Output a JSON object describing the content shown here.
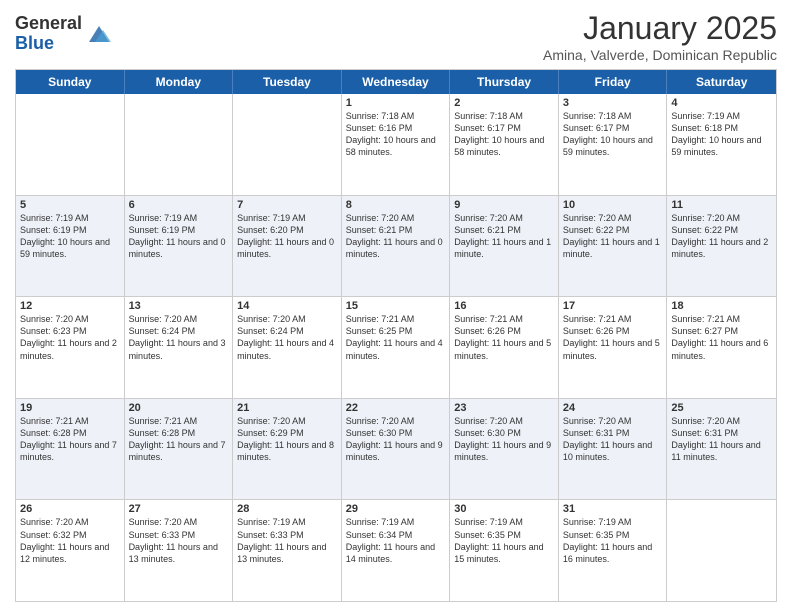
{
  "logo": {
    "general": "General",
    "blue": "Blue"
  },
  "header": {
    "month": "January 2025",
    "location": "Amina, Valverde, Dominican Republic"
  },
  "days": [
    "Sunday",
    "Monday",
    "Tuesday",
    "Wednesday",
    "Thursday",
    "Friday",
    "Saturday"
  ],
  "weeks": [
    [
      {
        "day": "",
        "info": ""
      },
      {
        "day": "",
        "info": ""
      },
      {
        "day": "",
        "info": ""
      },
      {
        "day": "1",
        "info": "Sunrise: 7:18 AM\nSunset: 6:16 PM\nDaylight: 10 hours and 58 minutes."
      },
      {
        "day": "2",
        "info": "Sunrise: 7:18 AM\nSunset: 6:17 PM\nDaylight: 10 hours and 58 minutes."
      },
      {
        "day": "3",
        "info": "Sunrise: 7:18 AM\nSunset: 6:17 PM\nDaylight: 10 hours and 59 minutes."
      },
      {
        "day": "4",
        "info": "Sunrise: 7:19 AM\nSunset: 6:18 PM\nDaylight: 10 hours and 59 minutes."
      }
    ],
    [
      {
        "day": "5",
        "info": "Sunrise: 7:19 AM\nSunset: 6:19 PM\nDaylight: 10 hours and 59 minutes."
      },
      {
        "day": "6",
        "info": "Sunrise: 7:19 AM\nSunset: 6:19 PM\nDaylight: 11 hours and 0 minutes."
      },
      {
        "day": "7",
        "info": "Sunrise: 7:19 AM\nSunset: 6:20 PM\nDaylight: 11 hours and 0 minutes."
      },
      {
        "day": "8",
        "info": "Sunrise: 7:20 AM\nSunset: 6:21 PM\nDaylight: 11 hours and 0 minutes."
      },
      {
        "day": "9",
        "info": "Sunrise: 7:20 AM\nSunset: 6:21 PM\nDaylight: 11 hours and 1 minute."
      },
      {
        "day": "10",
        "info": "Sunrise: 7:20 AM\nSunset: 6:22 PM\nDaylight: 11 hours and 1 minute."
      },
      {
        "day": "11",
        "info": "Sunrise: 7:20 AM\nSunset: 6:22 PM\nDaylight: 11 hours and 2 minutes."
      }
    ],
    [
      {
        "day": "12",
        "info": "Sunrise: 7:20 AM\nSunset: 6:23 PM\nDaylight: 11 hours and 2 minutes."
      },
      {
        "day": "13",
        "info": "Sunrise: 7:20 AM\nSunset: 6:24 PM\nDaylight: 11 hours and 3 minutes."
      },
      {
        "day": "14",
        "info": "Sunrise: 7:20 AM\nSunset: 6:24 PM\nDaylight: 11 hours and 4 minutes."
      },
      {
        "day": "15",
        "info": "Sunrise: 7:21 AM\nSunset: 6:25 PM\nDaylight: 11 hours and 4 minutes."
      },
      {
        "day": "16",
        "info": "Sunrise: 7:21 AM\nSunset: 6:26 PM\nDaylight: 11 hours and 5 minutes."
      },
      {
        "day": "17",
        "info": "Sunrise: 7:21 AM\nSunset: 6:26 PM\nDaylight: 11 hours and 5 minutes."
      },
      {
        "day": "18",
        "info": "Sunrise: 7:21 AM\nSunset: 6:27 PM\nDaylight: 11 hours and 6 minutes."
      }
    ],
    [
      {
        "day": "19",
        "info": "Sunrise: 7:21 AM\nSunset: 6:28 PM\nDaylight: 11 hours and 7 minutes."
      },
      {
        "day": "20",
        "info": "Sunrise: 7:21 AM\nSunset: 6:28 PM\nDaylight: 11 hours and 7 minutes."
      },
      {
        "day": "21",
        "info": "Sunrise: 7:20 AM\nSunset: 6:29 PM\nDaylight: 11 hours and 8 minutes."
      },
      {
        "day": "22",
        "info": "Sunrise: 7:20 AM\nSunset: 6:30 PM\nDaylight: 11 hours and 9 minutes."
      },
      {
        "day": "23",
        "info": "Sunrise: 7:20 AM\nSunset: 6:30 PM\nDaylight: 11 hours and 9 minutes."
      },
      {
        "day": "24",
        "info": "Sunrise: 7:20 AM\nSunset: 6:31 PM\nDaylight: 11 hours and 10 minutes."
      },
      {
        "day": "25",
        "info": "Sunrise: 7:20 AM\nSunset: 6:31 PM\nDaylight: 11 hours and 11 minutes."
      }
    ],
    [
      {
        "day": "26",
        "info": "Sunrise: 7:20 AM\nSunset: 6:32 PM\nDaylight: 11 hours and 12 minutes."
      },
      {
        "day": "27",
        "info": "Sunrise: 7:20 AM\nSunset: 6:33 PM\nDaylight: 11 hours and 13 minutes."
      },
      {
        "day": "28",
        "info": "Sunrise: 7:19 AM\nSunset: 6:33 PM\nDaylight: 11 hours and 13 minutes."
      },
      {
        "day": "29",
        "info": "Sunrise: 7:19 AM\nSunset: 6:34 PM\nDaylight: 11 hours and 14 minutes."
      },
      {
        "day": "30",
        "info": "Sunrise: 7:19 AM\nSunset: 6:35 PM\nDaylight: 11 hours and 15 minutes."
      },
      {
        "day": "31",
        "info": "Sunrise: 7:19 AM\nSunset: 6:35 PM\nDaylight: 11 hours and 16 minutes."
      },
      {
        "day": "",
        "info": ""
      }
    ]
  ]
}
